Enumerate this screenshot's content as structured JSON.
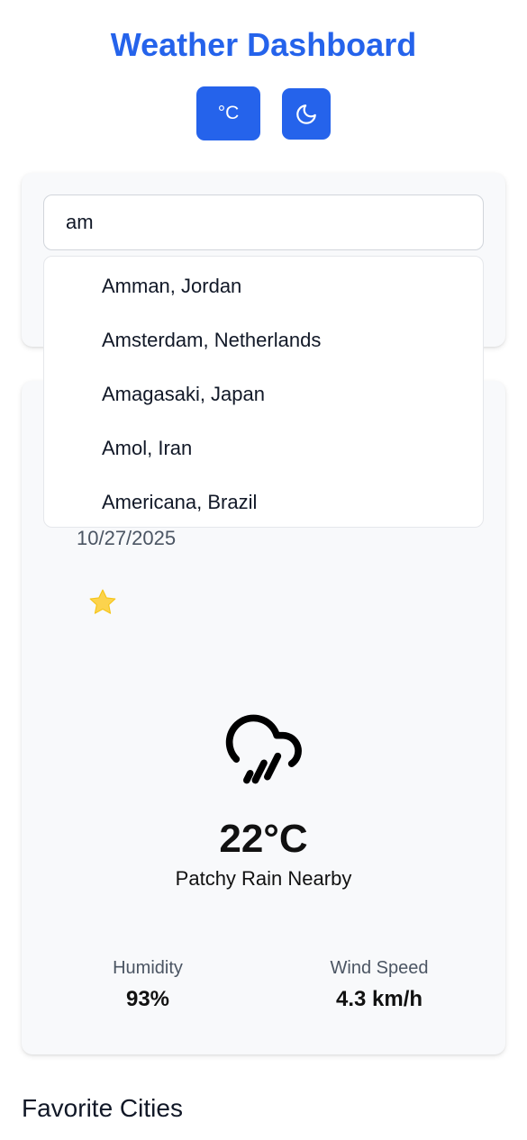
{
  "header": {
    "title": "Weather Dashboard",
    "unit_toggle_label": "°C",
    "theme_toggle_icon": "moon-icon"
  },
  "search": {
    "value": "am",
    "suggestions": [
      "Amman, Jordan",
      "Amsterdam, Netherlands",
      "Amagasaki, Japan",
      "Amol, Iran",
      "Americana, Brazil"
    ]
  },
  "weather": {
    "date": "10/27/2025",
    "favorite_icon": "star-icon",
    "condition_icon": "rain-cloud-icon",
    "temperature": "22°C",
    "condition": "Patchy Rain Nearby",
    "humidity_label": "Humidity",
    "humidity_value": "93%",
    "wind_label": "Wind Speed",
    "wind_value": "4.3 km/h"
  },
  "favorites": {
    "title": "Favorite Cities"
  },
  "colors": {
    "accent": "#2563eb",
    "star": "#fcd34d",
    "card_background": "#f8f9fb"
  }
}
